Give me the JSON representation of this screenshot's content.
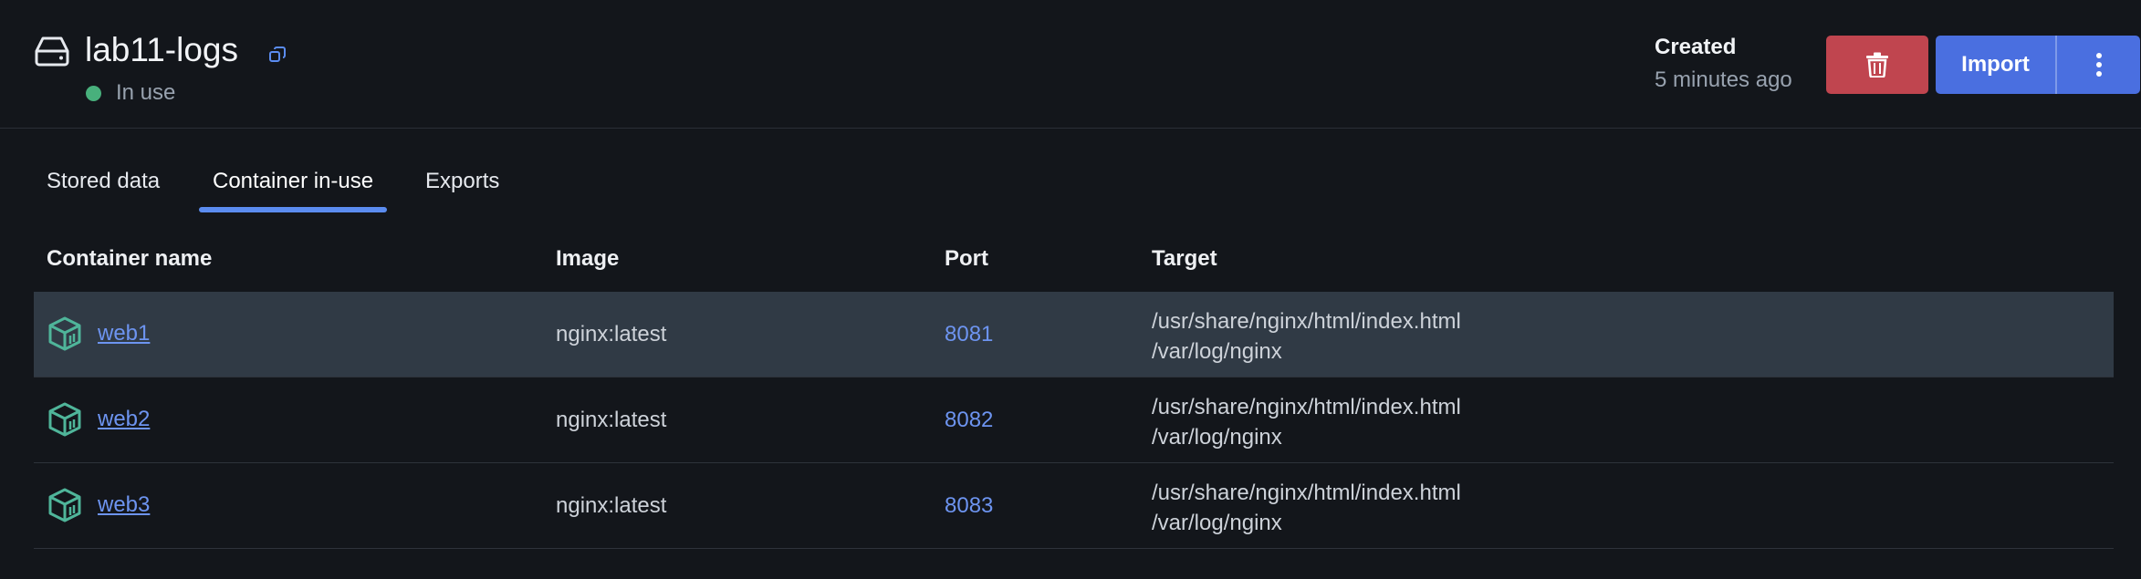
{
  "volume": {
    "name": "lab11-logs",
    "status": "In use",
    "status_color": "#48b07c"
  },
  "created": {
    "label": "Created",
    "value": "5 minutes ago"
  },
  "actions": {
    "delete_icon": "trash-icon",
    "import_label": "Import",
    "more_icon": "kebab-icon",
    "delete_color": "#c0454f",
    "primary_color": "#4a6fe0"
  },
  "tabs": [
    {
      "label": "Stored data",
      "active": false
    },
    {
      "label": "Container in-use",
      "active": true
    },
    {
      "label": "Exports",
      "active": false
    }
  ],
  "table": {
    "columns": [
      "Container name",
      "Image",
      "Port",
      "Target"
    ],
    "rows": [
      {
        "name": "web1",
        "image": "nginx:latest",
        "port": "8081",
        "targets": [
          "/usr/share/nginx/html/index.html",
          "/var/log/nginx"
        ],
        "selected": true
      },
      {
        "name": "web2",
        "image": "nginx:latest",
        "port": "8082",
        "targets": [
          "/usr/share/nginx/html/index.html",
          "/var/log/nginx"
        ],
        "selected": false
      },
      {
        "name": "web3",
        "image": "nginx:latest",
        "port": "8083",
        "targets": [
          "/usr/share/nginx/html/index.html",
          "/var/log/nginx"
        ],
        "selected": false
      }
    ]
  }
}
